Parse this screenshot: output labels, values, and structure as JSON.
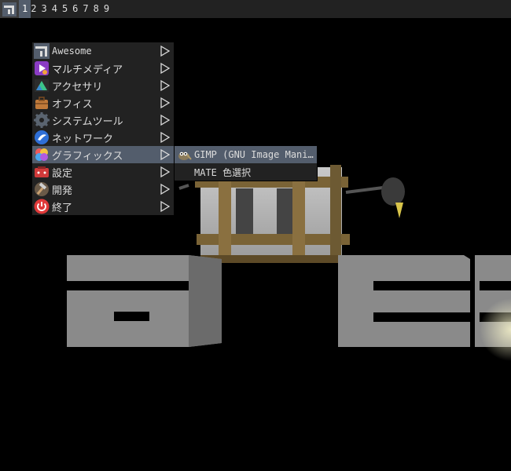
{
  "wibar": {
    "launcher_icon": "awesome-logo-icon",
    "tags": [
      "1",
      "2",
      "3",
      "4",
      "5",
      "6",
      "7",
      "8",
      "9"
    ],
    "active_tag": "1"
  },
  "main_menu": {
    "items": [
      {
        "label": "Awesome",
        "icon": "awesome-icon"
      },
      {
        "label": "マルチメディア",
        "icon": "multimedia-icon"
      },
      {
        "label": "アクセサリ",
        "icon": "accessories-icon"
      },
      {
        "label": "オフィス",
        "icon": "office-icon"
      },
      {
        "label": "システムツール",
        "icon": "system-tools-icon"
      },
      {
        "label": "ネットワーク",
        "icon": "network-icon"
      },
      {
        "label": "グラフィックス",
        "icon": "graphics-icon"
      },
      {
        "label": "設定",
        "icon": "settings-icon"
      },
      {
        "label": "開発",
        "icon": "development-icon"
      },
      {
        "label": "終了",
        "icon": "power-icon"
      }
    ],
    "focused": "グラフィックス"
  },
  "sub_menu": {
    "items": [
      {
        "label": "GIMP (GNU Image Mani…",
        "icon": "gimp-icon"
      },
      {
        "label": "MATE 色選択",
        "icon": ""
      }
    ],
    "focused": "GIMP (GNU Image Mani…"
  },
  "colors": {
    "bar_bg": "#222222",
    "focus_bg": "#535d6c",
    "fg": "#dcdcdc"
  }
}
